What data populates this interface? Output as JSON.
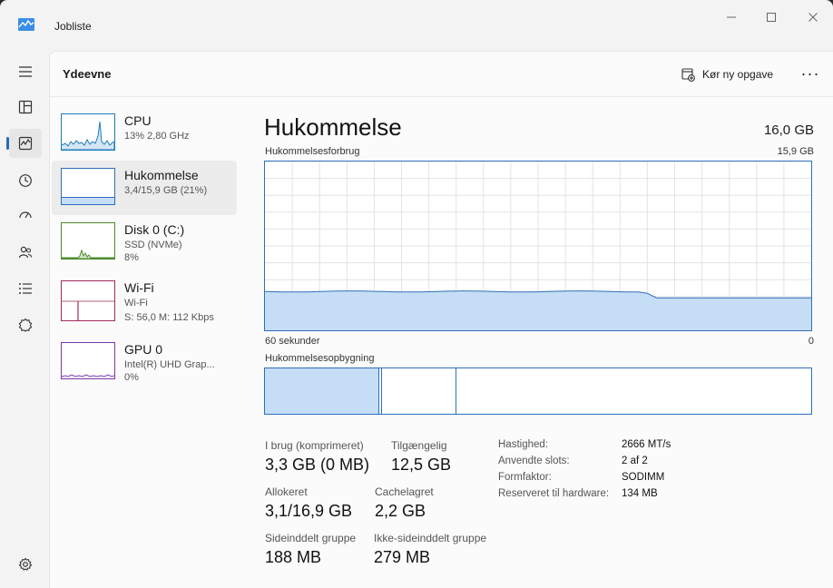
{
  "window": {
    "title": "Jobliste",
    "minimize_icon": "minimize-icon",
    "maximize_icon": "maximize-icon",
    "close_icon": "close-icon"
  },
  "nav": {
    "items": [
      {
        "name": "hamburger-menu-icon"
      },
      {
        "name": "processes-icon"
      },
      {
        "name": "performance-icon",
        "active": true
      },
      {
        "name": "app-history-icon"
      },
      {
        "name": "startup-apps-icon"
      },
      {
        "name": "users-icon"
      },
      {
        "name": "details-icon"
      },
      {
        "name": "services-icon"
      },
      {
        "name": "settings-icon"
      }
    ]
  },
  "header": {
    "title": "Ydeevne",
    "run_task_label": "Kør ny opgave",
    "more_label": "···"
  },
  "devices": [
    {
      "name": "CPU",
      "line1": "13% 2,80 GHz",
      "line2": "",
      "color": "#1c7bb8"
    },
    {
      "name": "Hukommelse",
      "line1": "3,4/15,9 GB (21%)",
      "line2": "",
      "color": "#2f6fba",
      "selected": true,
      "level": 0.21
    },
    {
      "name": "Disk 0 (C:)",
      "line1": "SSD (NVMe)",
      "line2": "8%",
      "color": "#4d8a2e"
    },
    {
      "name": "Wi-Fi",
      "line1": "Wi-Fi",
      "line2": "S: 56,0 M: 112 Kbps",
      "color": "#a12a5e"
    },
    {
      "name": "GPU 0",
      "line1": "Intel(R) UHD Grap...",
      "line2": "0%",
      "color": "#7d3aa8"
    }
  ],
  "memory": {
    "title": "Hukommelse",
    "total": "16,0 GB",
    "usage_label": "Hukommelsesforbrug",
    "usage_max": "15,9 GB",
    "time_label": "60 sekunder",
    "time_end": "0",
    "composition_label": "Hukommelsesopbygning",
    "usage_level": 0.23,
    "composition": {
      "in_use": 0.21,
      "modified": 0.005,
      "standby": 0.135
    },
    "stats": [
      {
        "label": "I brug (komprimeret)",
        "value": "3,3 GB (0 MB)"
      },
      {
        "label": "Tilgængelig",
        "value": "12,5 GB"
      },
      {
        "label": "Allokeret",
        "value": "3,1/16,9 GB"
      },
      {
        "label": "Cachelagret",
        "value": "2,2 GB"
      },
      {
        "label": "Sideinddelt gruppe",
        "value": "188 MB"
      },
      {
        "label": "Ikke-sideinddelt gruppe",
        "value": "279 MB"
      }
    ],
    "details": [
      {
        "label": "Hastighed:",
        "value": "2666 MT/s"
      },
      {
        "label": "Anvendte slots:",
        "value": "2 af 2"
      },
      {
        "label": "Formfaktor:",
        "value": "SODIMM"
      },
      {
        "label": "Reserveret til hardware:",
        "value": "134 MB"
      }
    ]
  },
  "colors": {
    "accent": "#2f6fba",
    "fill": "#c6ddf6"
  }
}
